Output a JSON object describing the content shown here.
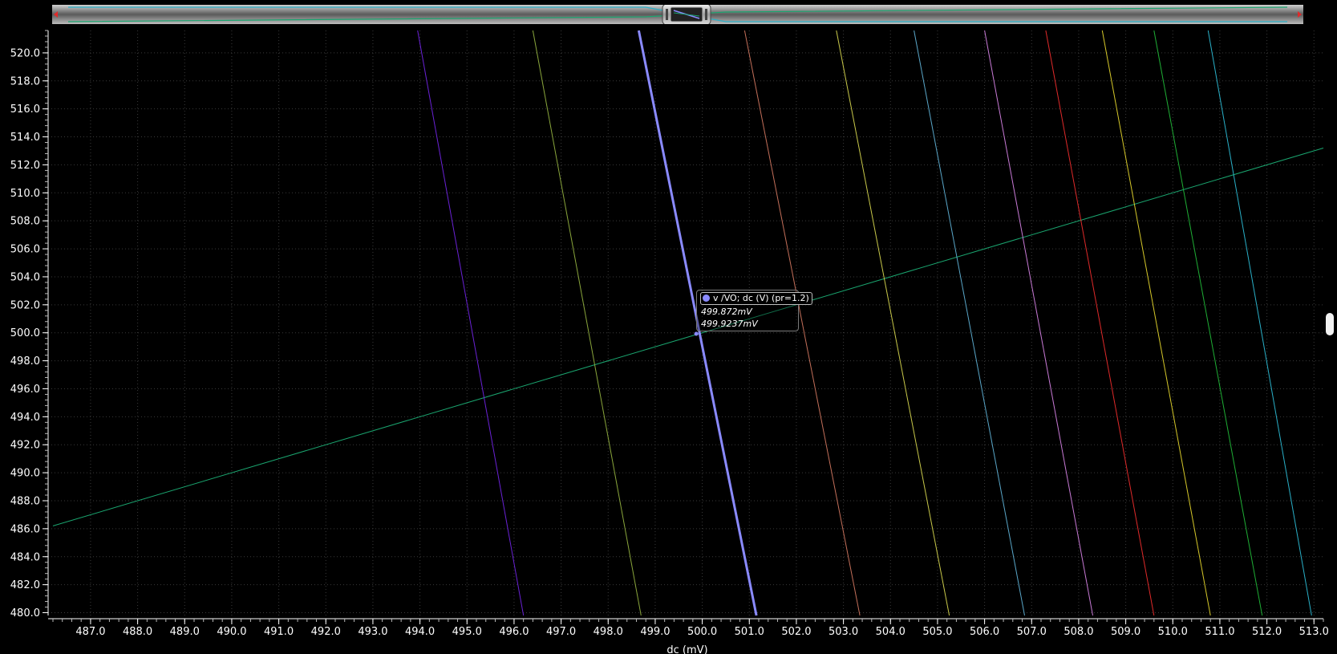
{
  "chart_data": {
    "type": "line",
    "xlabel": "dc (mV)",
    "ylabel": "",
    "xlim": [
      486.2,
      513.2
    ],
    "ylim": [
      479.8,
      521.6
    ],
    "xticks": [
      "487.0",
      "488.0",
      "489.0",
      "490.0",
      "491.0",
      "492.0",
      "493.0",
      "494.0",
      "495.0",
      "496.0",
      "497.0",
      "498.0",
      "499.0",
      "500.0",
      "501.0",
      "502.0",
      "503.0",
      "504.0",
      "505.0",
      "506.0",
      "507.0",
      "508.0",
      "509.0",
      "510.0",
      "511.0",
      "512.0",
      "513.0"
    ],
    "yticks": [
      "480.0",
      "482.0",
      "484.0",
      "486.0",
      "488.0",
      "490.0",
      "492.0",
      "494.0",
      "496.0",
      "498.0",
      "500.0",
      "502.0",
      "504.0",
      "506.0",
      "508.0",
      "510.0",
      "512.0",
      "514.0",
      "516.0",
      "518.0",
      "520.0"
    ],
    "grid": true,
    "series": [
      {
        "color": "#1aa56f",
        "width": 1,
        "x": [
          486.2,
          513.2
        ],
        "y": [
          486.2,
          513.2
        ]
      },
      {
        "color": "#6a22d6",
        "width": 1,
        "x": [
          493.95,
          496.2
        ],
        "y": [
          521.6,
          479.8
        ]
      },
      {
        "color": "#8aa63c",
        "width": 1,
        "x": [
          496.4,
          498.7
        ],
        "y": [
          521.6,
          479.8
        ]
      },
      {
        "color": "#8a8aff",
        "width": 3,
        "x": [
          498.65,
          501.15
        ],
        "y": [
          521.6,
          479.8
        ]
      },
      {
        "color": "#c4705a",
        "width": 1,
        "x": [
          500.9,
          503.35
        ],
        "y": [
          521.6,
          479.8
        ]
      },
      {
        "color": "#c9c94a",
        "width": 1,
        "x": [
          502.85,
          505.25
        ],
        "y": [
          521.6,
          479.8
        ]
      },
      {
        "color": "#5aa7c9",
        "width": 1,
        "x": [
          504.5,
          506.85
        ],
        "y": [
          521.6,
          479.8
        ]
      },
      {
        "color": "#c87ad6",
        "width": 1,
        "x": [
          506.0,
          508.3
        ],
        "y": [
          521.6,
          479.8
        ]
      },
      {
        "color": "#e02a2a",
        "width": 1,
        "x": [
          507.3,
          509.6
        ],
        "y": [
          521.6,
          479.8
        ]
      },
      {
        "color": "#d6c82a",
        "width": 1,
        "x": [
          508.5,
          510.8
        ],
        "y": [
          521.6,
          479.8
        ]
      },
      {
        "color": "#1fae35",
        "width": 1,
        "x": [
          509.6,
          511.9
        ],
        "y": [
          521.6,
          479.8
        ]
      },
      {
        "color": "#2ab0c8",
        "width": 1,
        "x": [
          510.75,
          512.95
        ],
        "y": [
          521.6,
          479.8
        ]
      }
    ]
  },
  "marker": {
    "title": "v /VO; dc (V) (pr=1.2)",
    "x_value": "499.872mV",
    "y_value": "499.9237mV",
    "color": "#8a8aff"
  }
}
